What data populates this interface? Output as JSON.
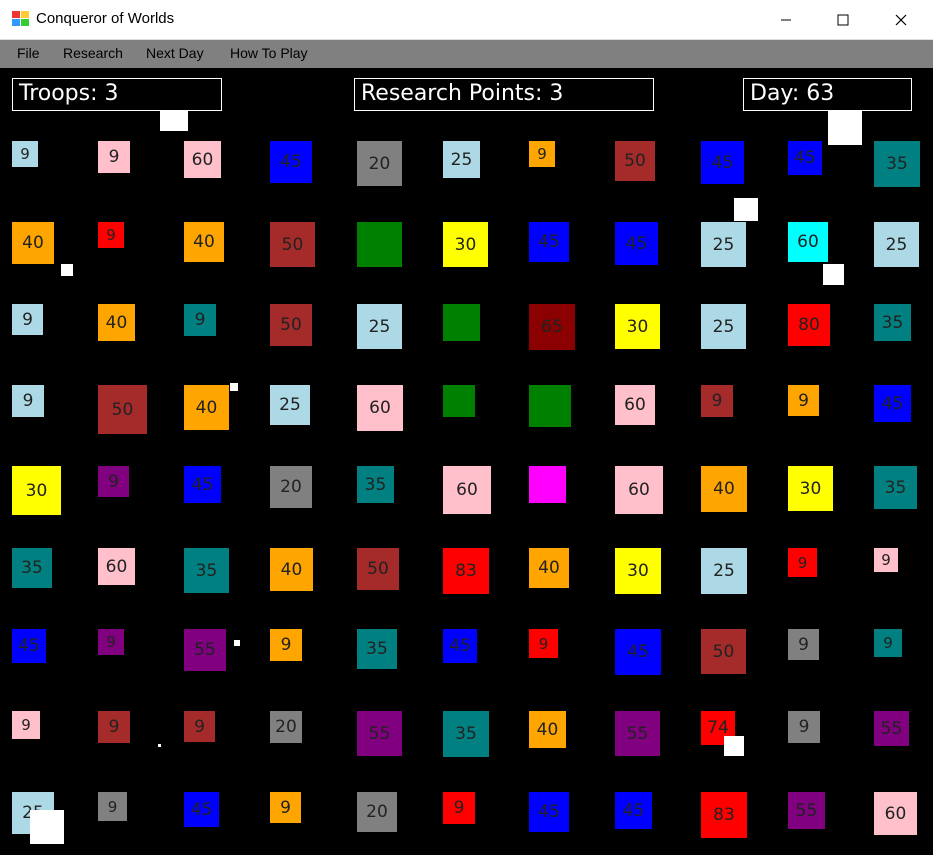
{
  "window": {
    "title": "Conqueror of Worlds",
    "controls": {
      "minimize": "minimize",
      "maximize": "maximize",
      "close": "close"
    }
  },
  "menu": {
    "items": [
      "File",
      "Research",
      "Next Day",
      "How To Play"
    ]
  },
  "hud": {
    "troops": "Troops: 3",
    "research": "Research Points: 3",
    "day": "Day: 63"
  },
  "colors": {
    "lightblue": "#add8e6",
    "pink": "#ffc0cb",
    "blue": "#0000ff",
    "gray": "#808080",
    "orange": "#ffa500",
    "brown": "#a52a2a",
    "teal": "#008080",
    "red": "#ff0000",
    "green": "#008000",
    "yellow": "#ffff00",
    "cyan": "#00ffff",
    "darkred": "#8b0000",
    "purple": "#800080",
    "magenta": "#ff00ff",
    "textdark": "#000000"
  },
  "grid": {
    "rows": [
      [
        {
          "label": "9",
          "color": "lightblue"
        },
        {
          "label": "9",
          "color": "pink"
        },
        {
          "label": "60",
          "color": "pink"
        },
        {
          "label": "45",
          "color": "blue"
        },
        {
          "label": "20",
          "color": "gray"
        },
        {
          "label": "25",
          "color": "lightblue"
        },
        {
          "label": "9",
          "color": "orange"
        },
        {
          "label": "50",
          "color": "brown"
        },
        {
          "label": "45",
          "color": "blue"
        },
        {
          "label": "45",
          "color": "blue"
        },
        {
          "label": "35",
          "color": "teal"
        }
      ],
      [
        {
          "label": "40",
          "color": "orange"
        },
        {
          "label": "9",
          "color": "red"
        },
        {
          "label": "40",
          "color": "orange"
        },
        {
          "label": "50",
          "color": "brown"
        },
        {
          "label": "",
          "color": "green"
        },
        {
          "label": "30",
          "color": "yellow"
        },
        {
          "label": "45",
          "color": "blue"
        },
        {
          "label": "45",
          "color": "blue"
        },
        {
          "label": "25",
          "color": "lightblue"
        },
        {
          "label": "60",
          "color": "cyan"
        },
        {
          "label": "25",
          "color": "lightblue"
        }
      ],
      [
        {
          "label": "9",
          "color": "lightblue"
        },
        {
          "label": "40",
          "color": "orange"
        },
        {
          "label": "9",
          "color": "teal"
        },
        {
          "label": "50",
          "color": "brown"
        },
        {
          "label": "25",
          "color": "lightblue"
        },
        {
          "label": "",
          "color": "green"
        },
        {
          "label": "65",
          "color": "darkred"
        },
        {
          "label": "30",
          "color": "yellow"
        },
        {
          "label": "25",
          "color": "lightblue"
        },
        {
          "label": "80",
          "color": "red"
        },
        {
          "label": "35",
          "color": "teal"
        }
      ],
      [
        {
          "label": "9",
          "color": "lightblue"
        },
        {
          "label": "50",
          "color": "brown"
        },
        {
          "label": "40",
          "color": "orange"
        },
        {
          "label": "25",
          "color": "lightblue"
        },
        {
          "label": "60",
          "color": "pink"
        },
        {
          "label": "",
          "color": "green"
        },
        {
          "label": "",
          "color": "green"
        },
        {
          "label": "60",
          "color": "pink"
        },
        {
          "label": "9",
          "color": "brown"
        },
        {
          "label": "9",
          "color": "orange"
        },
        {
          "label": "45",
          "color": "blue"
        }
      ],
      [
        {
          "label": "30",
          "color": "yellow"
        },
        {
          "label": "9",
          "color": "purple"
        },
        {
          "label": "45",
          "color": "blue"
        },
        {
          "label": "20",
          "color": "gray"
        },
        {
          "label": "35",
          "color": "teal"
        },
        {
          "label": "60",
          "color": "pink"
        },
        {
          "label": "",
          "color": "magenta"
        },
        {
          "label": "60",
          "color": "pink"
        },
        {
          "label": "40",
          "color": "orange"
        },
        {
          "label": "30",
          "color": "yellow"
        },
        {
          "label": "35",
          "color": "teal"
        }
      ],
      [
        {
          "label": "35",
          "color": "teal"
        },
        {
          "label": "60",
          "color": "pink"
        },
        {
          "label": "35",
          "color": "teal"
        },
        {
          "label": "40",
          "color": "orange"
        },
        {
          "label": "50",
          "color": "brown"
        },
        {
          "label": "83",
          "color": "red"
        },
        {
          "label": "40",
          "color": "orange"
        },
        {
          "label": "30",
          "color": "yellow"
        },
        {
          "label": "25",
          "color": "lightblue"
        },
        {
          "label": "9",
          "color": "red"
        },
        {
          "label": "9",
          "color": "pink"
        }
      ],
      [
        {
          "label": "45",
          "color": "blue"
        },
        {
          "label": "9",
          "color": "purple"
        },
        {
          "label": "55",
          "color": "purple"
        },
        {
          "label": "9",
          "color": "orange"
        },
        {
          "label": "35",
          "color": "teal"
        },
        {
          "label": "45",
          "color": "blue"
        },
        {
          "label": "9",
          "color": "red"
        },
        {
          "label": "45",
          "color": "blue"
        },
        {
          "label": "50",
          "color": "brown"
        },
        {
          "label": "9",
          "color": "gray"
        },
        {
          "label": "9",
          "color": "teal"
        }
      ],
      [
        {
          "label": "9",
          "color": "pink"
        },
        {
          "label": "9",
          "color": "brown"
        },
        {
          "label": "9",
          "color": "brown"
        },
        {
          "label": "20",
          "color": "gray"
        },
        {
          "label": "55",
          "color": "purple"
        },
        {
          "label": "35",
          "color": "teal"
        },
        {
          "label": "40",
          "color": "orange"
        },
        {
          "label": "55",
          "color": "purple"
        },
        {
          "label": "74",
          "color": "red"
        },
        {
          "label": "9",
          "color": "gray"
        },
        {
          "label": "55",
          "color": "purple"
        }
      ],
      [
        {
          "label": "25",
          "color": "lightblue"
        },
        {
          "label": "9",
          "color": "gray"
        },
        {
          "label": "45",
          "color": "blue"
        },
        {
          "label": "9",
          "color": "orange"
        },
        {
          "label": "20",
          "color": "gray"
        },
        {
          "label": "9",
          "color": "red"
        },
        {
          "label": "45",
          "color": "blue"
        },
        {
          "label": "45",
          "color": "blue"
        },
        {
          "label": "83",
          "color": "red"
        },
        {
          "label": "55",
          "color": "purple"
        },
        {
          "label": "60",
          "color": "pink"
        }
      ]
    ]
  }
}
